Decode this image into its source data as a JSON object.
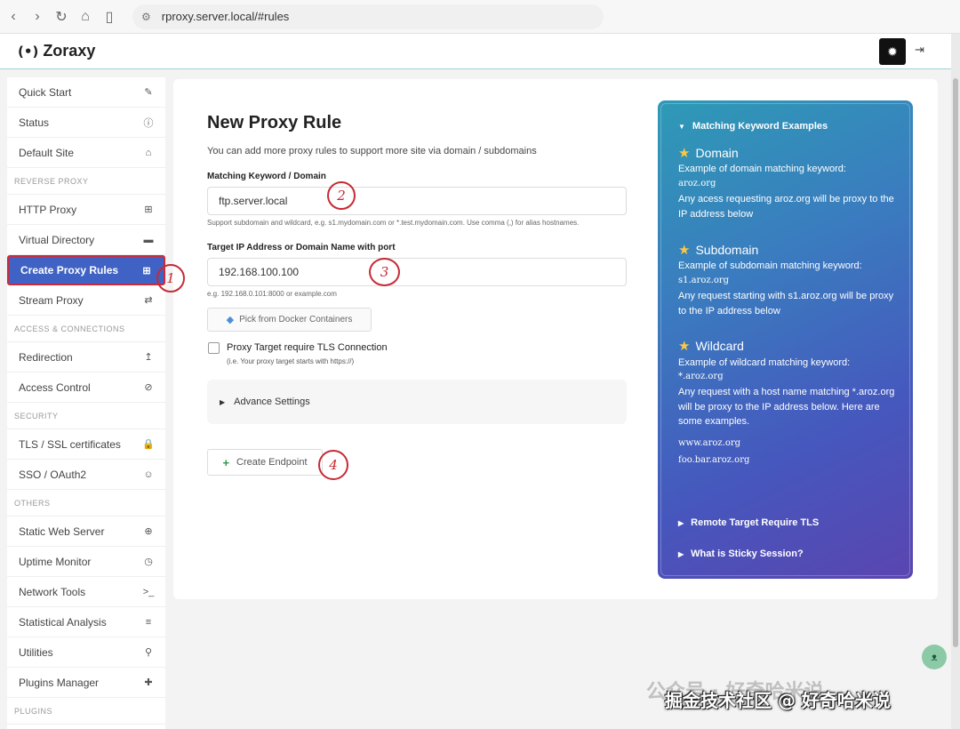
{
  "browser": {
    "url": "rproxy.server.local/#rules"
  },
  "app": {
    "name": "Zoraxy",
    "logo_mark": "(•)"
  },
  "sidebar": {
    "groups": [
      {
        "section": null,
        "items": [
          {
            "label": "Quick Start",
            "icon": "✎",
            "name": "sidebar-item-quick-start",
            "icon_name": "wand-icon"
          },
          {
            "label": "Status",
            "icon": "ⓘ",
            "name": "sidebar-item-status",
            "icon_name": "info-icon"
          },
          {
            "label": "Default Site",
            "icon": "⌂",
            "name": "sidebar-item-default-site",
            "icon_name": "home-icon"
          }
        ]
      },
      {
        "section": "REVERSE PROXY",
        "items": [
          {
            "label": "HTTP Proxy",
            "icon": "⊞",
            "name": "sidebar-item-http-proxy",
            "icon_name": "sitemap-icon"
          },
          {
            "label": "Virtual Directory",
            "icon": "▬",
            "name": "sidebar-item-virtual-directory",
            "icon_name": "folder-icon"
          },
          {
            "label": "Create Proxy Rules",
            "icon": "⊞",
            "name": "sidebar-item-create-proxy-rules",
            "icon_name": "add-box-icon",
            "active": true
          },
          {
            "label": "Stream Proxy",
            "icon": "⇄",
            "name": "sidebar-item-stream-proxy",
            "icon_name": "exchange-icon"
          }
        ]
      },
      {
        "section": "ACCESS & CONNECTIONS",
        "items": [
          {
            "label": "Redirection",
            "icon": "↥",
            "name": "sidebar-item-redirection",
            "icon_name": "redirect-arrow-icon"
          },
          {
            "label": "Access Control",
            "icon": "⊘",
            "name": "sidebar-item-access-control",
            "icon_name": "ban-icon"
          }
        ]
      },
      {
        "section": "SECURITY",
        "items": [
          {
            "label": "TLS / SSL certificates",
            "icon": "🔒",
            "name": "sidebar-item-tls-ssl",
            "icon_name": "lock-icon"
          },
          {
            "label": "SSO / OAuth2",
            "icon": "☺",
            "name": "sidebar-item-sso-oauth2",
            "icon_name": "user-circle-icon"
          }
        ]
      },
      {
        "section": "OTHERS",
        "items": [
          {
            "label": "Static Web Server",
            "icon": "⊕",
            "name": "sidebar-item-static-web-server",
            "icon_name": "globe-icon"
          },
          {
            "label": "Uptime Monitor",
            "icon": "◷",
            "name": "sidebar-item-uptime-monitor",
            "icon_name": "clock-icon"
          },
          {
            "label": "Network Tools",
            "icon": ">_",
            "name": "sidebar-item-network-tools",
            "icon_name": "terminal-icon"
          },
          {
            "label": "Statistical Analysis",
            "icon": "≡",
            "name": "sidebar-item-statistical-analysis",
            "icon_name": "database-icon"
          },
          {
            "label": "Utilities",
            "icon": "⚲",
            "name": "sidebar-item-utilities",
            "icon_name": "paperclip-icon"
          },
          {
            "label": "Plugins Manager",
            "icon": "✚",
            "name": "sidebar-item-plugins-manager",
            "icon_name": "puzzle-icon"
          }
        ]
      },
      {
        "section": "PLUGINS",
        "items": []
      }
    ]
  },
  "form": {
    "title": "New Proxy Rule",
    "description": "You can add more proxy rules to support more site via domain / subdomains",
    "keyword_label": "Matching Keyword / Domain",
    "keyword_value": "ftp.server.local",
    "keyword_hint": "Support subdomain and wildcard, e.g. s1.mydomain.com or *.test.mydomain.com. Use comma (,) for alias hostnames.",
    "target_label": "Target IP Address or Domain Name with port",
    "target_value": "192.168.100.100",
    "target_hint": "e.g. 192.168.0.101:8000 or example.com",
    "docker_button": "Pick from Docker Containers",
    "tls_checkbox_label": "Proxy Target require TLS Connection",
    "tls_checkbox_sub": "(i.e. Your proxy target starts with https://)",
    "tls_checked": false,
    "advance_settings": "Advance Settings",
    "create_button": "Create Endpoint"
  },
  "annotations": [
    "1",
    "2",
    "3",
    "4"
  ],
  "info_panel": {
    "header": "Matching Keyword Examples",
    "domain": {
      "title": "Domain",
      "line1": "Example of domain matching keyword:",
      "example": "aroz.org",
      "line2": "Any acess requesting aroz.org will be proxy to the IP address below"
    },
    "subdomain": {
      "title": "Subdomain",
      "line1": "Example of subdomain matching keyword:",
      "example": "s1.aroz.org",
      "line2": "Any request starting with s1.aroz.org will be proxy to the IP address below"
    },
    "wildcard": {
      "title": "Wildcard",
      "line1": "Example of wildcard matching keyword:",
      "example": "*.aroz.org",
      "line2": "Any request with a host name matching *.aroz.org will be proxy to the IP address below. Here are some examples.",
      "examples": [
        "www.aroz.org",
        "foo.bar.aroz.org"
      ]
    },
    "remote_tls": "Remote Target Require TLS",
    "sticky_session": "What is Sticky Session?"
  },
  "watermark": {
    "line1": "公众号 · 好奇哈米说",
    "line2": "掘金技术社区 @ 好奇哈米说"
  }
}
